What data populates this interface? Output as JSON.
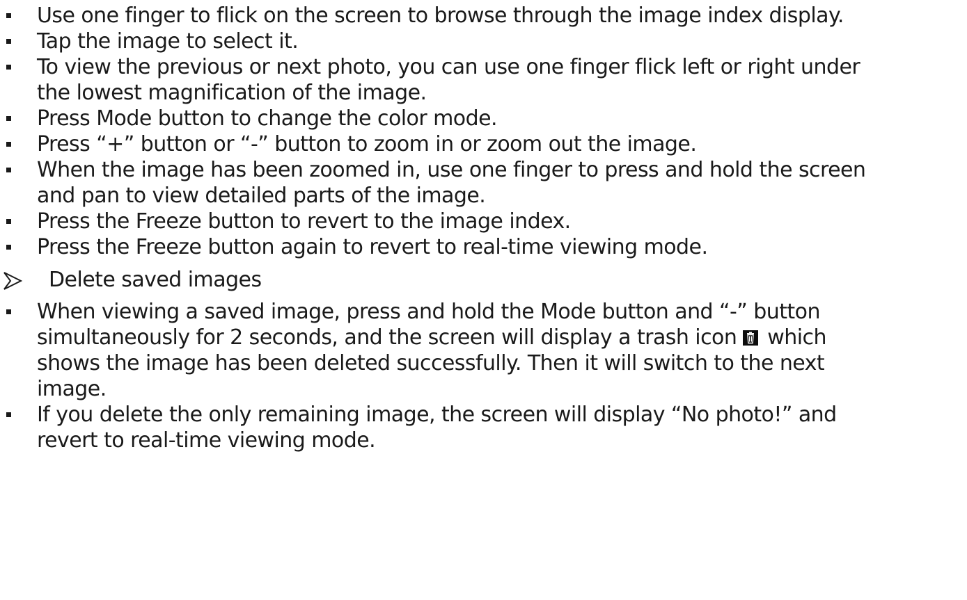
{
  "instructions": {
    "items": [
      {
        "lines": [
          "Use one finger to flick on the screen to browse through the image index display."
        ]
      },
      {
        "lines": [
          "Tap the image to select it."
        ]
      },
      {
        "lines": [
          "To view the previous or next photo, you can use one finger flick left or right under",
          "the lowest magnification of the image."
        ]
      },
      {
        "lines": [
          "Press Mode button to change the color mode."
        ]
      },
      {
        "lines": [
          "Press “+” button or “-” button to zoom in or zoom out the image."
        ]
      },
      {
        "lines": [
          "When the image has been zoomed in, use one finger to press and hold the screen",
          "and pan to view detailed parts of the image."
        ]
      },
      {
        "lines": [
          "Press the Freeze button to revert to the  image index."
        ]
      },
      {
        "lines": [
          "Press the Freeze button again to revert to real-time viewing mode."
        ]
      }
    ]
  },
  "delete_section": {
    "heading": "Delete saved images",
    "heading_icon": "arrow-bullet-icon",
    "item1": {
      "line1": "When viewing a saved image, press and hold the Mode button and “-” button",
      "line2_before_icon": "simultaneously for 2 seconds, and the screen will display a trash icon",
      "inline_icon": "trash-icon",
      "line2_after_icon": " which",
      "line3": "shows the image has been deleted successfully. Then it will switch to the next",
      "line4": "image."
    },
    "item2": {
      "line1": "If you delete the only remaining image, the screen will display “No photo!” and",
      "line2": "revert to real-time viewing mode."
    }
  }
}
